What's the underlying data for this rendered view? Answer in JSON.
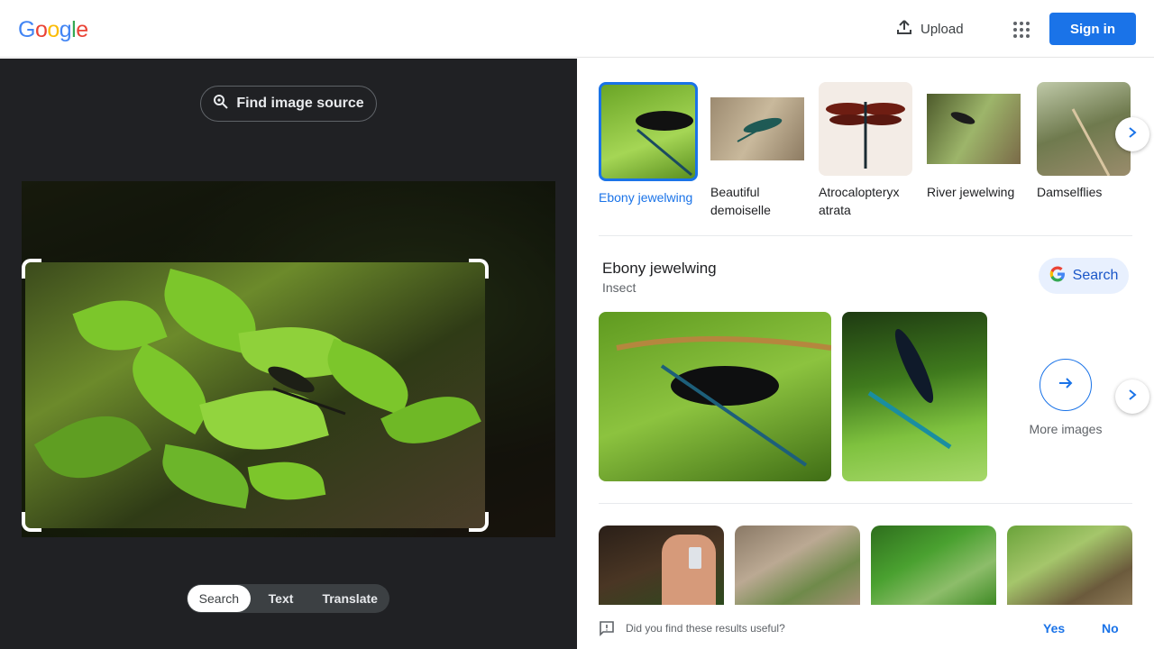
{
  "header": {
    "logo": [
      "G",
      "o",
      "o",
      "g",
      "l",
      "e"
    ],
    "logo_colors": [
      "#4285F4",
      "#EA4335",
      "#FBBC05",
      "#4285F4",
      "#34A853",
      "#EA4335"
    ],
    "upload_label": "Upload",
    "apps_icon": "apps-grid-icon",
    "signin_label": "Sign in"
  },
  "left": {
    "find_source_label": "Find image source",
    "modes": [
      "Search",
      "Text",
      "Translate"
    ],
    "active_mode": "Search"
  },
  "related": [
    {
      "label": "Ebony jewelwing",
      "selected": true
    },
    {
      "label": "Beautiful demoiselle",
      "selected": false
    },
    {
      "label": "Atrocalopteryx atrata",
      "selected": false
    },
    {
      "label": "River jewelwing",
      "selected": false
    },
    {
      "label": "Damselflies",
      "selected": false
    }
  ],
  "entity": {
    "title": "Ebony jewelwing",
    "subtitle": "Insect",
    "search_label": "Search",
    "more_images_label": "More images"
  },
  "feedback": {
    "question": "Did you find these results useful?",
    "yes_label": "Yes",
    "no_label": "No"
  },
  "colors": {
    "accent": "#1a73e8",
    "dark_panel": "#202124"
  }
}
